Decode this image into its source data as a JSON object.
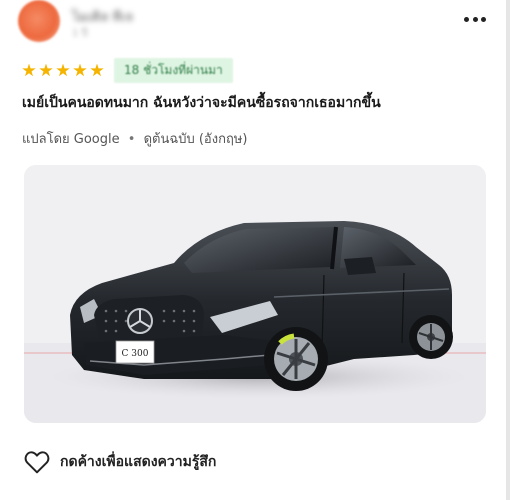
{
  "reviewer": {
    "name": "ไมเคิล ทีเจ",
    "sub": "1 ปี"
  },
  "rating": {
    "stars": 5,
    "max_stars": 5,
    "time_badge": "18 ชั่วโมงที่ผ่านมา"
  },
  "review_text": "เมย์เป็นคนอดทนมาก ฉันหวังว่าจะมีคนซื้อรถจากเธอมากขึ้น",
  "translation": {
    "translated_by": "แปลโดย Google",
    "separator": "•",
    "view_original": "ดูต้นฉบับ (อังกฤษ)"
  },
  "photo": {
    "plate_text": "C 300"
  },
  "actions": {
    "like_label": "กดค้างเพื่อแสดงความรู้สึก"
  },
  "icons": {
    "more": "more-dots-icon",
    "star": "star-icon",
    "heart": "heart-outline-icon"
  },
  "colors": {
    "star": "#f5b400",
    "badge_bg": "#dff5e3",
    "badge_text": "#2e7d46",
    "avatar": "#ee6a3f",
    "brake_caliper": "#c9e33a"
  }
}
